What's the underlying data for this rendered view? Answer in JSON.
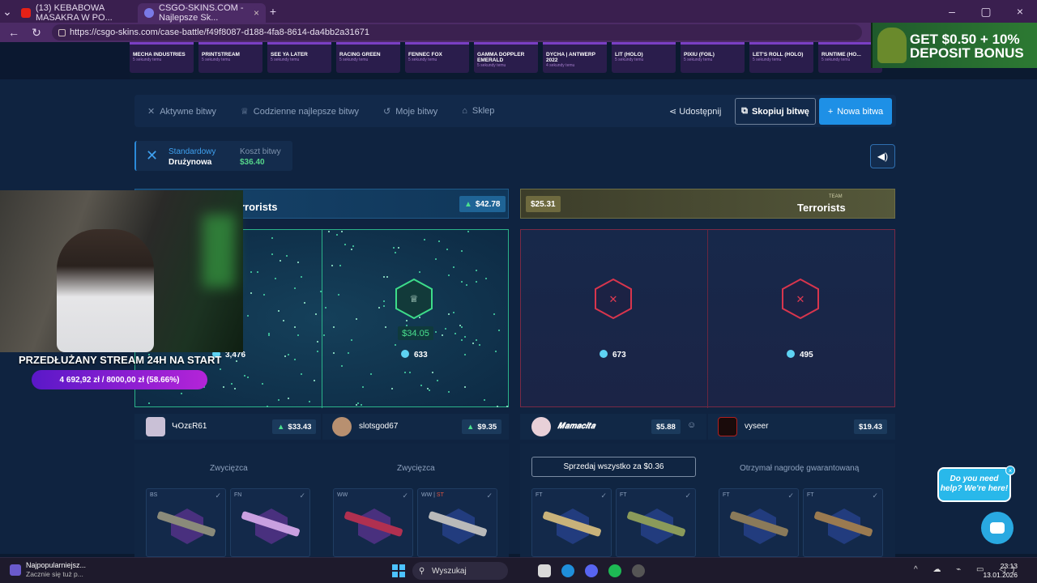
{
  "browser": {
    "tabs": [
      {
        "title": "(13) KEBABOWA MASAKRA W PO..."
      },
      {
        "title": "CSGO-SKINS.COM - Najlepsze Sk..."
      }
    ],
    "url": "https://csgo-skins.com/case-battle/f49f8087-d188-4fa8-8614-da4bb2a31671"
  },
  "case_strip": [
    {
      "name": "MECHA INDUSTRIES",
      "time": "5 sekundy temu"
    },
    {
      "name": "PRINTSTREAM",
      "time": "5 sekundy temu"
    },
    {
      "name": "SEE YA LATER",
      "time": "5 sekundy temu"
    },
    {
      "name": "RACING GREEN",
      "time": "5 sekundy temu"
    },
    {
      "name": "FENNEC FOX",
      "time": "5 sekundy temu"
    },
    {
      "name": "GAMMA DOPPLER EMERALD",
      "time": "5 sekundy temu"
    },
    {
      "name": "DYCHA | ANTWERP 2022",
      "time": "4 sekundy temu"
    },
    {
      "name": "LIT (HOLO)",
      "time": "5 sekundy temu"
    },
    {
      "name": "PIXIU (FOIL)",
      "time": "5 sekundy temu"
    },
    {
      "name": "LET'S ROLL (HOLO)",
      "time": "5 sekundy temu"
    },
    {
      "name": "RUNTIME (HO...",
      "time": "5 sekundy temu"
    }
  ],
  "promo": {
    "text": "GET $0.50 + 10% DEPOSIT BONUS"
  },
  "nav": {
    "active": "Aktywne bitwy",
    "daily": "Codzienne najlepsze bitwy",
    "mine": "Moje bitwy",
    "shop": "Sklep",
    "share": "Udostępnij",
    "copy": "Skopiuj bitwę",
    "new": "Nowa bitwa"
  },
  "mode": {
    "type": "Standardowy",
    "sub": "Drużynowa",
    "cost_label": "Koszt bitwy",
    "cost": "$36.40"
  },
  "teams": {
    "ct": {
      "name": "rrorists",
      "total": "$42.78"
    },
    "t": {
      "label": "TEAM",
      "name": "Terrorists",
      "total": "$25.31"
    }
  },
  "panels": {
    "ct1_coins": "3,476",
    "ct2_coins": "633",
    "ct2_win": "$34.05",
    "t1_coins": "673",
    "t2_coins": "495"
  },
  "players": [
    {
      "name": "ԿՕzᴇR61",
      "value": "$33.43",
      "status": "Zwycięzca"
    },
    {
      "name": "slotsgod67",
      "value": "$9.35",
      "status": "Zwycięzca"
    },
    {
      "name": "𝑴𝒂𝒎𝒂𝒄𝒊𝒕𝒂",
      "value": "$5.88",
      "action": "Sprzedaj wszystko za $0.36"
    },
    {
      "name": "vyseer",
      "value": "$19.43",
      "status": "Otrzymał nagrodę gwarantowaną"
    }
  ],
  "items": [
    {
      "cond": "BS",
      "st": ""
    },
    {
      "cond": "FN",
      "st": ""
    },
    {
      "cond": "WW",
      "st": ""
    },
    {
      "cond": "WW | ",
      "st": "ST"
    },
    {
      "cond": "FT",
      "st": ""
    },
    {
      "cond": "FT",
      "st": ""
    },
    {
      "cond": "FT",
      "st": ""
    },
    {
      "cond": "FT",
      "st": ""
    }
  ],
  "stream": {
    "title": "PRZEDŁUŻANY STREAM 24H NA START",
    "goal": "4 692,92 zł / 8000,00 zł (58.66%)",
    "goal_pct": 58.66
  },
  "help": {
    "text": "Do you need help? We're here!"
  },
  "taskbar": {
    "news_title": "Najpopularniejsz...",
    "news_sub": "Zacznie się tuż p...",
    "search": "Wyszukaj",
    "time": "23:13",
    "date": "13.01.2026"
  }
}
